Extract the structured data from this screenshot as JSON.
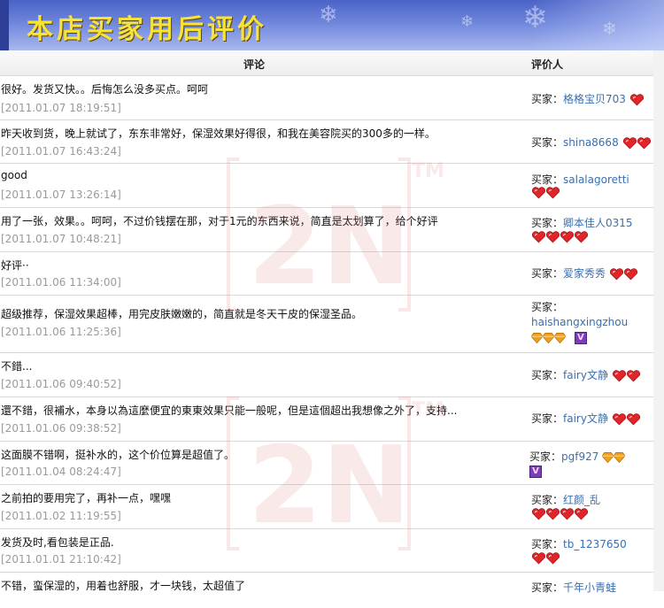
{
  "header": {
    "title": "本店买家用后评价"
  },
  "table": {
    "col_comment": "评论",
    "col_reviewer": "评价人"
  },
  "buyer_prefix": "买家：",
  "watermark": {
    "mark": "2N",
    "tm": "TM"
  },
  "colors": {
    "banner": "#5b73d3",
    "title": "#f7e23a",
    "link": "#3a6fb0",
    "date": "#9a9a9a",
    "heart": "#e0262b",
    "diamond": "#f0a020"
  },
  "rows": [
    {
      "comment": "很好。发货又快。。后悔怎么没多买点。呵呵",
      "date": "[2011.01.07 18:19:51]",
      "name": "格格宝贝703",
      "badges": "heart x1"
    },
    {
      "comment": "昨天收到货，晚上就试了，东东非常好，保湿效果好得很，和我在美容院买的300多的一样。",
      "date": "[2011.01.07 16:43:24]",
      "name": "shina8668",
      "badges": "heart x2"
    },
    {
      "comment": "good",
      "date": "[2011.01.07 13:26:14]",
      "name": "salalagoretti",
      "badges": "heart x2"
    },
    {
      "comment": "用了一张，效果。。呵呵，不过价钱摆在那，对于1元的东西来说，简直是太划算了，给个好评",
      "date": "[2011.01.07 10:48:21]",
      "name": "卿本佳人0315",
      "badges": "heart x4"
    },
    {
      "comment": "好评··",
      "date": "[2011.01.06 11:34:00]",
      "name": "爱家秀秀",
      "badges": "heart x2"
    },
    {
      "comment": "超级推荐，保湿效果超棒，用完皮肤嫩嫩的，简直就是冬天干皮的保湿圣品。",
      "date": "[2011.01.06 11:25:36]",
      "name": "haishangxingzhou",
      "badges": "diamond x3 + crown"
    },
    {
      "comment": "不錯...",
      "date": "[2011.01.06 09:40:52]",
      "name": "fairy文静",
      "badges": "heart x2"
    },
    {
      "comment": "還不錯，很補水，本身以為這麼便宜的東東效果只能一般呢，但是這個超出我想像之外了，支持...",
      "date": "[2011.01.06 09:38:52]",
      "name": "fairy文静",
      "badges": "heart x2"
    },
    {
      "comment": "这面膜不错啊，挺补水的，这个价位算是超值了。",
      "date": "[2011.01.04 08:24:47]",
      "name": "pgf927",
      "badges": "diamond x2 + crown"
    },
    {
      "comment": "之前拍的要用完了，再补一点，嘿嘿",
      "date": "[2011.01.02 11:19:55]",
      "name": "红颜_乱",
      "badges": "heart x4"
    },
    {
      "comment": "发货及时,看包装是正品.",
      "date": "[2011.01.01 21:10:42]",
      "name": "tb_1237650",
      "badges": "heart x2"
    },
    {
      "comment": "不错，蛮保湿的，用着也舒服，才一块钱，太超值了",
      "date": "",
      "name": "千年小青蛙",
      "badges": ""
    }
  ]
}
